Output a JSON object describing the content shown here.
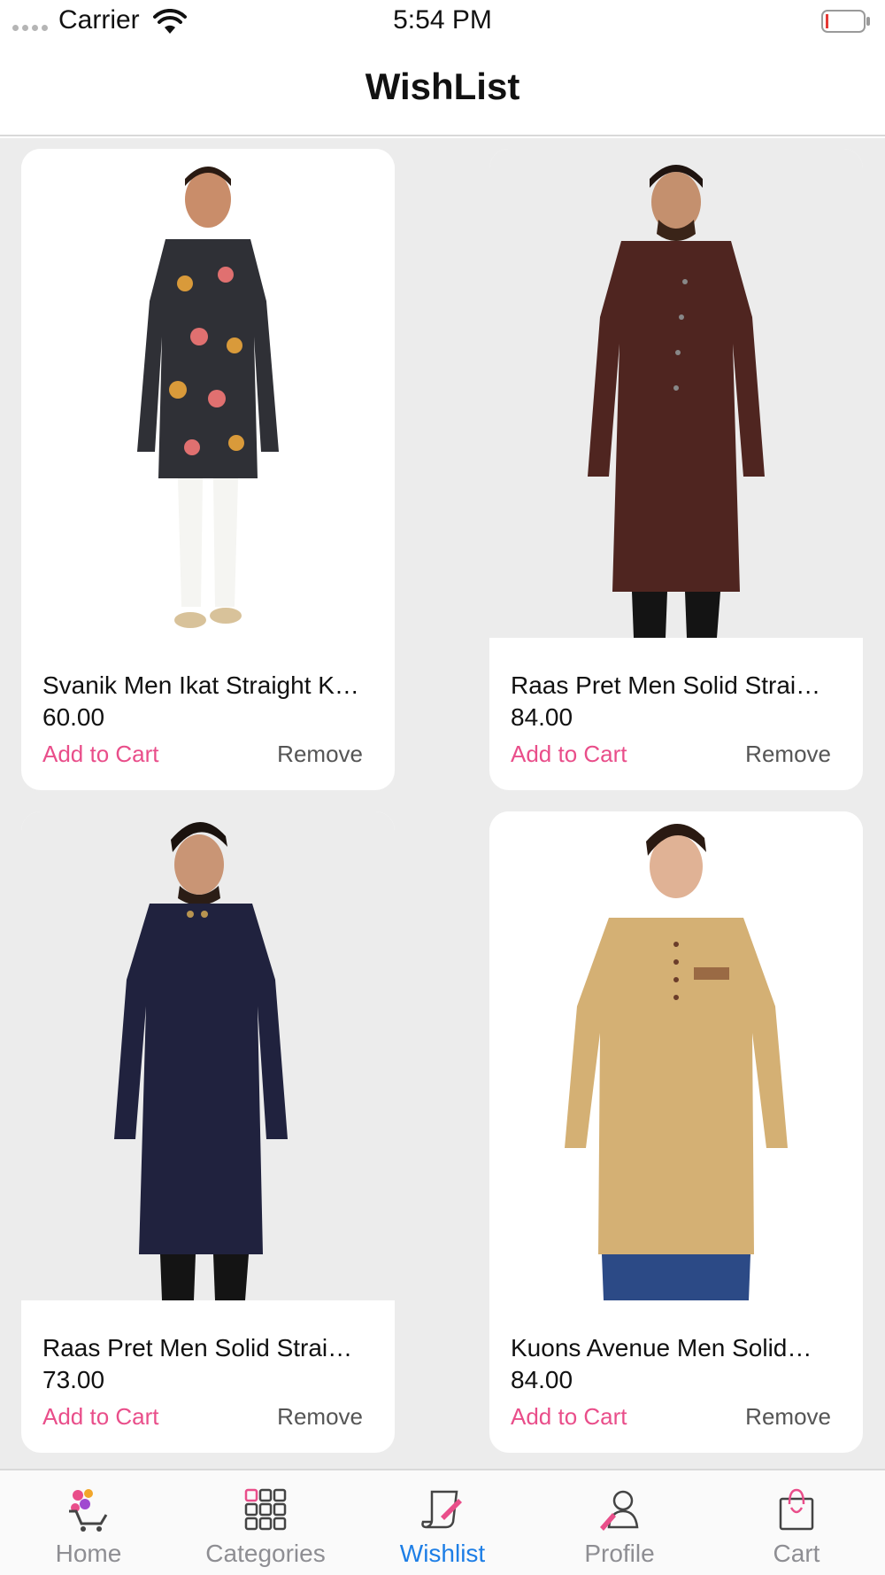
{
  "status_bar": {
    "carrier": "Carrier",
    "time": "5:54 PM"
  },
  "header": {
    "title": "WishList"
  },
  "products": [
    {
      "name": "Svanik Men Ikat Straight K…",
      "price": "60.00",
      "add_to_cart": "Add to Cart",
      "remove": "Remove"
    },
    {
      "name": "Raas Pret Men Solid Strai…",
      "price": "84.00",
      "add_to_cart": "Add to Cart",
      "remove": "Remove"
    },
    {
      "name": "Raas Pret Men Solid Strai…",
      "price": "73.00",
      "add_to_cart": "Add to Cart",
      "remove": "Remove"
    },
    {
      "name": "Kuons Avenue Men Solid…",
      "price": "84.00",
      "add_to_cart": "Add to Cart",
      "remove": "Remove"
    }
  ],
  "tabs": [
    {
      "label": "Home",
      "icon": "home-cart-icon"
    },
    {
      "label": "Categories",
      "icon": "categories-grid-icon"
    },
    {
      "label": "Wishlist",
      "icon": "wishlist-scroll-icon",
      "active": true
    },
    {
      "label": "Profile",
      "icon": "profile-icon"
    },
    {
      "label": "Cart",
      "icon": "shopping-bag-icon"
    }
  ],
  "colors": {
    "accent_pink": "#e94e8a",
    "active_tab_blue": "#1d7ee6",
    "background": "#ececec"
  }
}
